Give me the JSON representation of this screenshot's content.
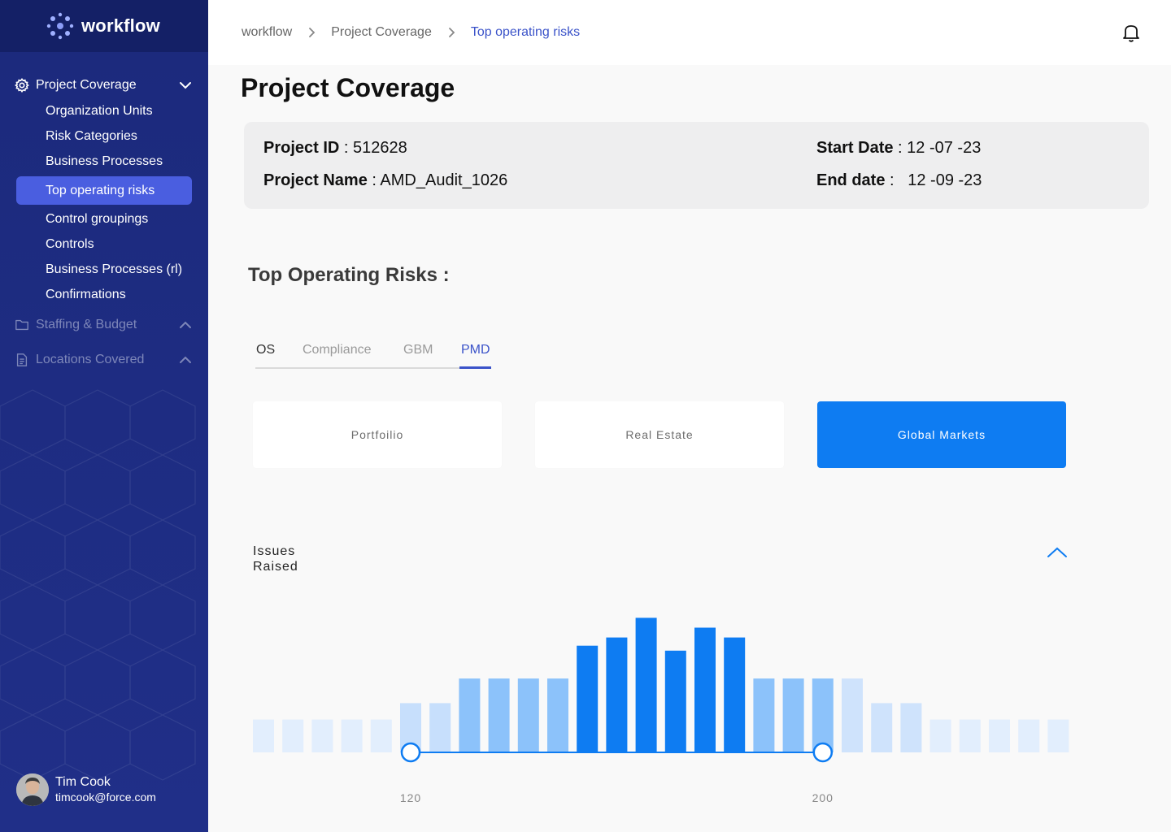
{
  "brand": {
    "name": "workflow",
    "logo_icon": "dots-logo-icon"
  },
  "sidebar": {
    "section_project": {
      "label": "Project Coverage",
      "icon": "gear-icon"
    },
    "items": [
      {
        "label": "Organization Units"
      },
      {
        "label": "Risk Categories"
      },
      {
        "label": "Business Processes"
      },
      {
        "label": "Top operating risks",
        "active": true
      },
      {
        "label": "Control groupings"
      },
      {
        "label": "Controls"
      },
      {
        "label": "Business Processes (rl)"
      },
      {
        "label": "Confirmations"
      }
    ],
    "section_staffing": {
      "label": "Staffing & Budget",
      "icon": "folder-icon"
    },
    "section_locations": {
      "label": "Locations Covered",
      "icon": "document-icon"
    }
  },
  "user": {
    "name": "Tim Cook",
    "email": "timcook@force.com"
  },
  "breadcrumb": [
    "workflow",
    "Project Coverage",
    "Top operating risks"
  ],
  "page": {
    "title": "Project Coverage"
  },
  "project": {
    "id_label": "Project ID",
    "id_value": "512628",
    "name_label": "Project Name",
    "name_value": "AMD_Audit_1026",
    "start_label": "Start Date",
    "start_value": "12 -07 -23",
    "end_label": "End date",
    "end_value": "12 -09 -23"
  },
  "risks": {
    "title": "Top Operating Risks :",
    "tabs": [
      "OS",
      "Compliance",
      "GBM",
      "PMD"
    ],
    "active_tab": "PMD",
    "cards": [
      "Portfoilio",
      "Real Estate",
      "Global Markets"
    ],
    "selected_card": "Global Markets"
  },
  "colors": {
    "accent": "#3b53c9",
    "primary": "#0e7cf2",
    "sidebar": "#1c2a7d"
  },
  "chart_data": {
    "type": "bar",
    "title": "Issues Raised",
    "values": [
      2,
      2,
      2,
      2,
      2,
      3,
      3,
      4.5,
      4.5,
      4.5,
      4.5,
      6.5,
      7,
      8.2,
      6.2,
      7.6,
      7,
      4.5,
      4.5,
      4.5,
      4.5,
      3,
      3,
      2,
      2,
      2,
      2,
      2
    ],
    "range_min": {
      "label": "120",
      "index": 5
    },
    "range_max": {
      "label": "200",
      "index": 19
    }
  }
}
